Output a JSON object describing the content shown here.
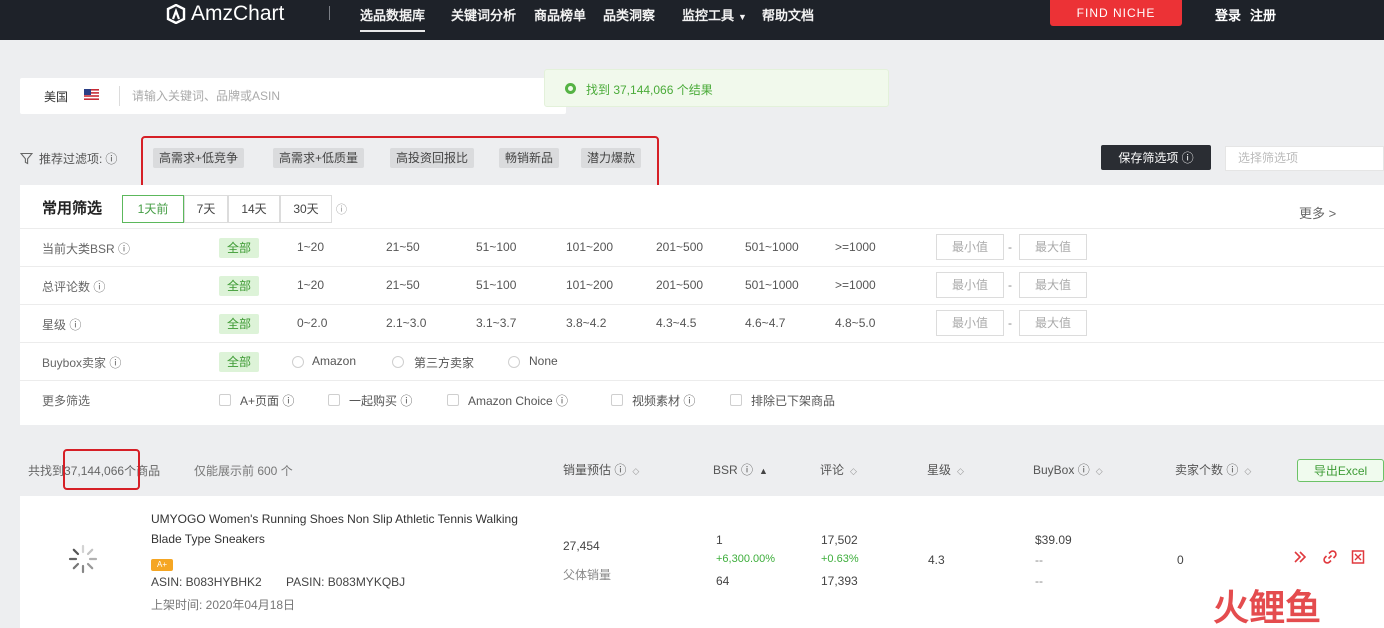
{
  "nav": {
    "brand": "AmzChart",
    "items": [
      "选品数据库",
      "关键词分析",
      "商品榜单",
      "品类洞察",
      "监控工具",
      "帮助文档"
    ],
    "active": "选品数据库",
    "find_niche": "FIND NICHE",
    "login": "登录",
    "register": "注册"
  },
  "search": {
    "market": "美国",
    "placeholder": "请输入关键词、品牌或ASIN"
  },
  "toast": {
    "text": "找到 37,144,066 个结果"
  },
  "recommend": {
    "label": "推荐过滤项:",
    "chips": [
      "高需求+低竞争",
      "高需求+低质量",
      "高投资回报比",
      "畅销新品",
      "潜力爆款"
    ],
    "save_button": "保存筛选项",
    "select_placeholder": "选择筛选项"
  },
  "panel": {
    "title": "常用筛选",
    "periods": [
      "1天前",
      "7天",
      "14天",
      "30天"
    ],
    "more": "更多 >",
    "min_placeholder": "最小值",
    "max_placeholder": "最大值",
    "rows": {
      "bsr": {
        "label": "当前大类BSR",
        "all": "全部",
        "options": [
          "1~20",
          "21~50",
          "51~100",
          "101~200",
          "201~500",
          "501~1000",
          ">=1000"
        ]
      },
      "reviews": {
        "label": "总评论数",
        "all": "全部",
        "options": [
          "1~20",
          "21~50",
          "51~100",
          "101~200",
          "201~500",
          "501~1000",
          ">=1000"
        ]
      },
      "rating": {
        "label": "星级",
        "all": "全部",
        "options": [
          "0~2.0",
          "2.1~3.0",
          "3.1~3.7",
          "3.8~4.2",
          "4.3~4.5",
          "4.6~4.7",
          "4.8~5.0"
        ]
      },
      "buybox": {
        "label": "Buybox卖家",
        "all": "全部",
        "options": [
          "Amazon",
          "第三方卖家",
          "None"
        ]
      },
      "more": {
        "label": "更多筛选",
        "options": [
          "A+页面",
          "一起购买",
          "Amazon Choice",
          "视频素材",
          "排除已下架商品"
        ]
      }
    }
  },
  "results": {
    "prefix": "共找到",
    "count": "37,144,066",
    "suffix": "个商品",
    "limit": "仅能展示前 600 个",
    "columns": [
      "销量预估",
      "BSR",
      "评论",
      "星级",
      "BuyBox",
      "卖家个数"
    ],
    "export": "导出Excel"
  },
  "product": {
    "title": "UMYOGO Women's Running Shoes Non Slip Athletic Tennis Walking Blade Type Sneakers",
    "badge": "A+",
    "asin": "ASIN: B083HYBHK2",
    "parent_asin": "PASIN: B083MYKQBJ",
    "date": "上架时间: 2020年04月18日",
    "sales": "27,454",
    "sales_sub": "父体销量",
    "bsr": "1",
    "bsr_change": "+6,300.00%",
    "bsr_sub": "64",
    "reviews": "17,502",
    "reviews_change": "+0.63%",
    "reviews_sub": "17,393",
    "rating": "4.3",
    "price": "$39.09",
    "price_sub1": "--",
    "price_sub2": "--",
    "sellers": "0"
  },
  "watermark": "火鲤鱼",
  "colors": {
    "nav_bg": "#1e2229",
    "find_niche": "#ec3236",
    "accent_green": "#3d9a33",
    "highlight_red": "#d61f26"
  }
}
